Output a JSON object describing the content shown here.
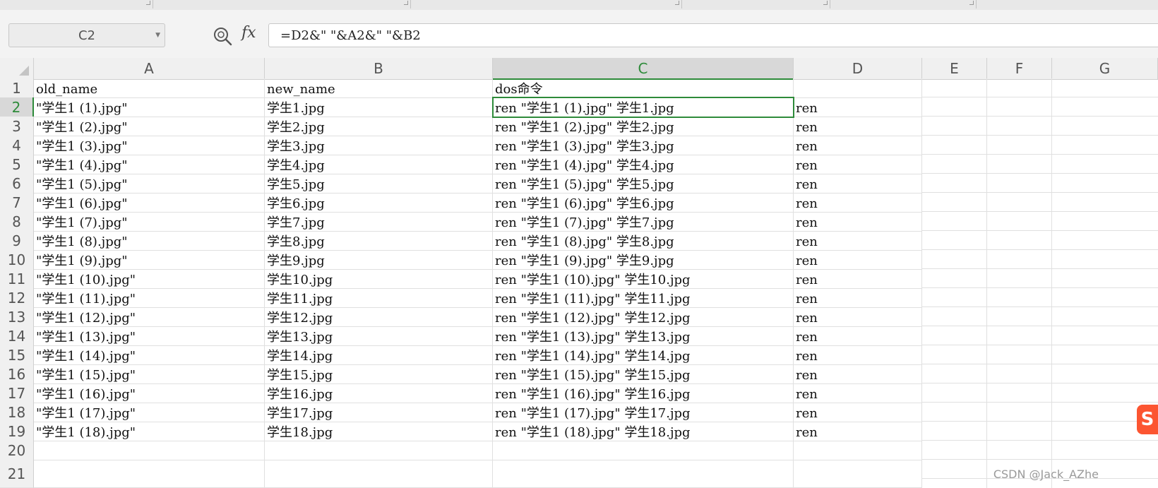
{
  "name_box": "C2",
  "formula_bar": {
    "fx_label": "fx",
    "formula": "=D2&\" \"&A2&\" \"&B2"
  },
  "columns": [
    "A",
    "B",
    "C",
    "D",
    "E",
    "F",
    "G"
  ],
  "selected_column": "C",
  "rows": [
    {
      "num": "1",
      "a": "old_name",
      "b": "new_name",
      "c": "dos命令",
      "d": ""
    },
    {
      "num": "2",
      "a": "\"学生1 (1).jpg\"",
      "b": "学生1.jpg",
      "c": "ren \"学生1 (1).jpg\" 学生1.jpg",
      "d": "ren"
    },
    {
      "num": "3",
      "a": "\"学生1 (2).jpg\"",
      "b": "学生2.jpg",
      "c": "ren \"学生1 (2).jpg\" 学生2.jpg",
      "d": "ren"
    },
    {
      "num": "4",
      "a": "\"学生1 (3).jpg\"",
      "b": "学生3.jpg",
      "c": "ren \"学生1 (3).jpg\" 学生3.jpg",
      "d": "ren"
    },
    {
      "num": "5",
      "a": "\"学生1 (4).jpg\"",
      "b": "学生4.jpg",
      "c": "ren \"学生1 (4).jpg\" 学生4.jpg",
      "d": "ren"
    },
    {
      "num": "6",
      "a": "\"学生1 (5).jpg\"",
      "b": "学生5.jpg",
      "c": "ren \"学生1 (5).jpg\" 学生5.jpg",
      "d": "ren"
    },
    {
      "num": "7",
      "a": "\"学生1 (6).jpg\"",
      "b": "学生6.jpg",
      "c": "ren \"学生1 (6).jpg\" 学生6.jpg",
      "d": "ren"
    },
    {
      "num": "8",
      "a": "\"学生1 (7).jpg\"",
      "b": "学生7.jpg",
      "c": "ren \"学生1 (7).jpg\" 学生7.jpg",
      "d": "ren"
    },
    {
      "num": "9",
      "a": "\"学生1 (8).jpg\"",
      "b": "学生8.jpg",
      "c": "ren \"学生1 (8).jpg\" 学生8.jpg",
      "d": "ren"
    },
    {
      "num": "10",
      "a": "\"学生1 (9).jpg\"",
      "b": "学生9.jpg",
      "c": "ren \"学生1 (9).jpg\" 学生9.jpg",
      "d": "ren"
    },
    {
      "num": "11",
      "a": "\"学生1 (10).jpg\"",
      "b": "学生10.jpg",
      "c": "ren \"学生1 (10).jpg\" 学生10.jpg",
      "d": "ren"
    },
    {
      "num": "12",
      "a": "\"学生1 (11).jpg\"",
      "b": "学生11.jpg",
      "c": "ren \"学生1 (11).jpg\" 学生11.jpg",
      "d": "ren"
    },
    {
      "num": "13",
      "a": "\"学生1 (12).jpg\"",
      "b": "学生12.jpg",
      "c": "ren \"学生1 (12).jpg\" 学生12.jpg",
      "d": "ren"
    },
    {
      "num": "14",
      "a": "\"学生1 (13).jpg\"",
      "b": "学生13.jpg",
      "c": "ren \"学生1 (13).jpg\" 学生13.jpg",
      "d": "ren"
    },
    {
      "num": "15",
      "a": "\"学生1 (14).jpg\"",
      "b": "学生14.jpg",
      "c": "ren \"学生1 (14).jpg\" 学生14.jpg",
      "d": "ren"
    },
    {
      "num": "16",
      "a": "\"学生1 (15).jpg\"",
      "b": "学生15.jpg",
      "c": "ren \"学生1 (15).jpg\" 学生15.jpg",
      "d": "ren"
    },
    {
      "num": "17",
      "a": "\"学生1 (16).jpg\"",
      "b": "学生16.jpg",
      "c": "ren \"学生1 (16).jpg\" 学生16.jpg",
      "d": "ren"
    },
    {
      "num": "18",
      "a": "\"学生1 (17).jpg\"",
      "b": "学生17.jpg",
      "c": "ren \"学生1 (17).jpg\" 学生17.jpg",
      "d": "ren"
    },
    {
      "num": "19",
      "a": "\"学生1 (18).jpg\"",
      "b": "学生18.jpg",
      "c": "ren \"学生1 (18).jpg\" 学生18.jpg",
      "d": "ren"
    },
    {
      "num": "20",
      "a": "",
      "b": "",
      "c": "",
      "d": ""
    },
    {
      "num": "21",
      "a": "",
      "b": "",
      "c": "",
      "d": ""
    }
  ],
  "icons": {
    "zoom": "zoom-formula-icon",
    "fx": "function-icon",
    "corner": "select-all-icon",
    "csdn": "csdn-logo-icon"
  },
  "logo_text": "S",
  "watermark": "CSDN @Jack_AZhe",
  "colors": {
    "selection_green": "#2e8b3a",
    "header_bg": "#f0f0f0",
    "grid": "#e0e0e0"
  }
}
